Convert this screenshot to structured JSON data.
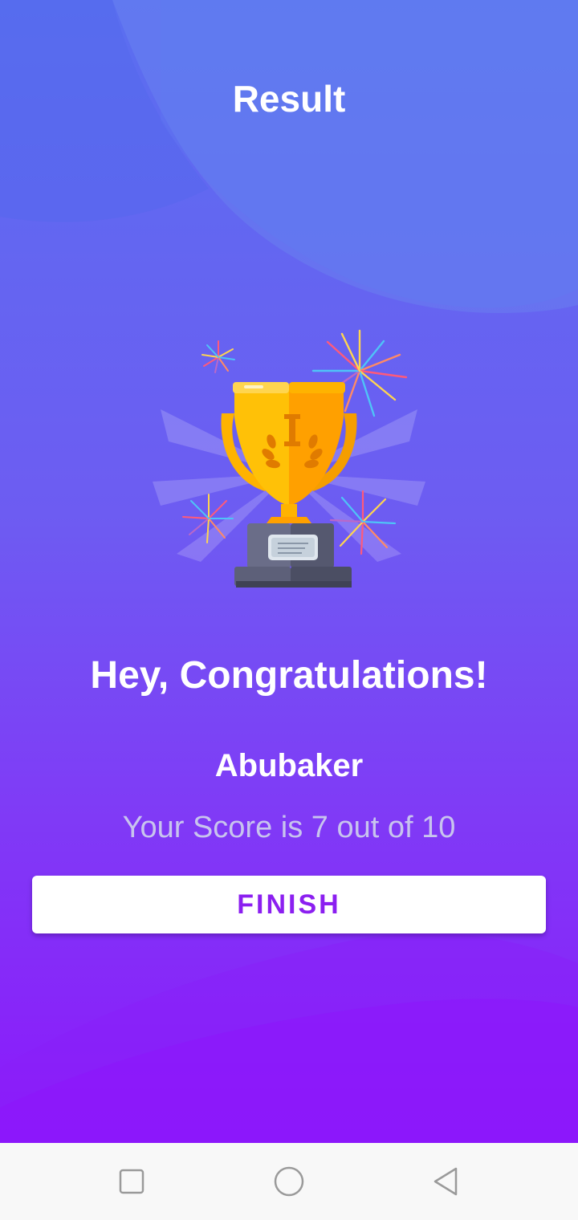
{
  "header": {
    "title": "Result"
  },
  "illustration": {
    "icon": "trophy-with-fireworks-icon",
    "cup_color": "#ffc107",
    "base_color": "#5a5d78"
  },
  "result": {
    "greeting": "Hey, Congratulations!",
    "user_name": "Abubaker",
    "score_text": "Your Score is 7 out of 10"
  },
  "actions": {
    "finish_label": "FINISH"
  },
  "system_nav": {
    "recents_icon": "square-icon",
    "home_icon": "circle-icon",
    "back_icon": "triangle-back-icon"
  },
  "colors": {
    "background_top": "#5a6ff0",
    "background_bottom": "#8c18fb",
    "button_text": "#8b1ff0",
    "score_text": "#c8c4ee"
  }
}
